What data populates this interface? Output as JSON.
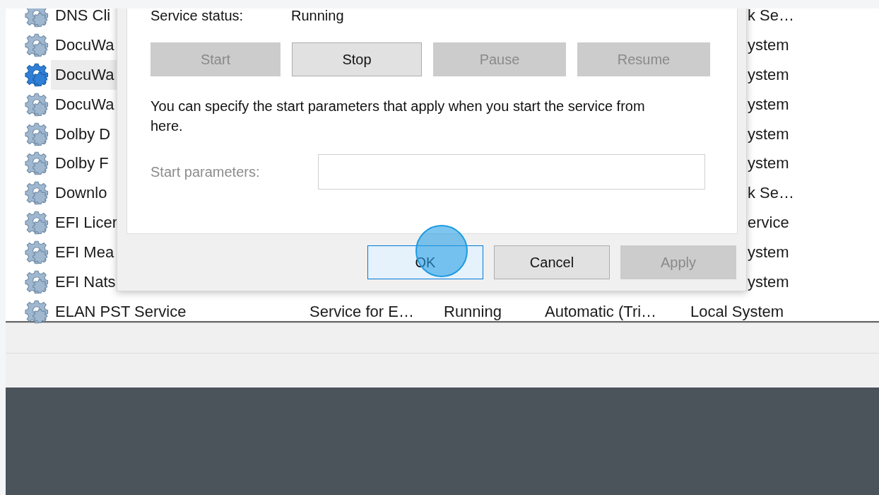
{
  "services": {
    "rows": [
      {
        "name": "DNS Cli",
        "logon": "k Se…",
        "selected": false
      },
      {
        "name": "DocuWa",
        "logon": "ystem",
        "selected": false
      },
      {
        "name": "DocuWa",
        "logon": "ystem",
        "selected": true
      },
      {
        "name": "DocuWa",
        "logon": "ystem",
        "selected": false
      },
      {
        "name": "Dolby D",
        "logon": "ystem",
        "selected": false
      },
      {
        "name": "Dolby F",
        "logon": "ystem",
        "selected": false
      },
      {
        "name": "Downlo",
        "logon": "k Se…",
        "selected": false
      },
      {
        "name": "EFI Licer",
        "logon": "ervice",
        "selected": false
      },
      {
        "name": "EFI Mea",
        "logon": "ystem",
        "selected": false
      },
      {
        "name": "EFI Nats",
        "logon": "ystem",
        "selected": false
      },
      {
        "name": "ELAN PST Service",
        "description": "Service for E…",
        "status": "Running",
        "startup": "Automatic (Tri…",
        "logon": "Local System",
        "selected": false
      }
    ]
  },
  "dialog": {
    "status_label": "Service status:",
    "status_value": "Running",
    "service_buttons": [
      {
        "label": "Start",
        "disabled": true
      },
      {
        "label": "Stop",
        "disabled": false
      },
      {
        "label": "Pause",
        "disabled": true
      },
      {
        "label": "Resume",
        "disabled": true
      }
    ],
    "hint": "You can specify the start parameters that apply when you start the service from here.",
    "params_label": "Start parameters:",
    "params_disabled": true,
    "buttons": [
      {
        "label": "OK",
        "default": true,
        "disabled": false
      },
      {
        "label": "Cancel",
        "default": false,
        "disabled": false
      },
      {
        "label": "Apply",
        "default": false,
        "disabled": true
      }
    ]
  }
}
